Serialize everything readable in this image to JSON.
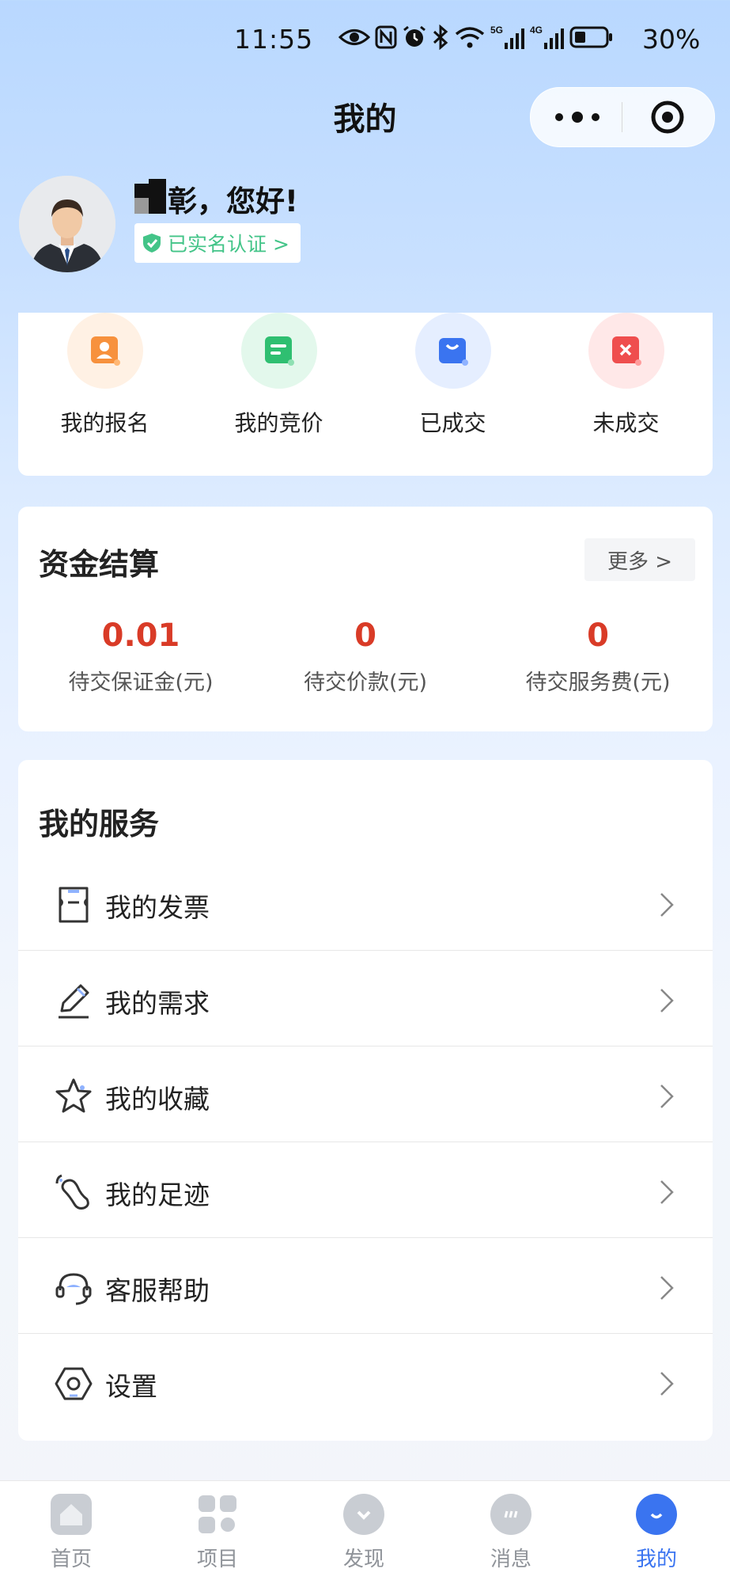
{
  "status_bar": {
    "time": "11:55",
    "battery": "30%",
    "signal_labels": [
      "5G",
      "4G"
    ]
  },
  "header": {
    "title": "我的"
  },
  "user": {
    "name_visible": "彰",
    "greeting": "彰，您好!",
    "verified_label": "已实名认证 >"
  },
  "quick_actions": [
    {
      "label": "我的报名",
      "color": "#f7913d",
      "bg": "#fff1e4",
      "icon": "registration-icon"
    },
    {
      "label": "我的竞价",
      "color": "#2fbf71",
      "bg": "#e3f8ec",
      "icon": "bidding-icon"
    },
    {
      "label": "已成交",
      "color": "#3a74f0",
      "bg": "#e5eeff",
      "icon": "deal-done-icon"
    },
    {
      "label": "未成交",
      "color": "#ef4e4e",
      "bg": "#ffe8e8",
      "icon": "deal-failed-icon"
    }
  ],
  "funds": {
    "title": "资金结算",
    "more_label": "更多 >",
    "items": [
      {
        "value": "0.01",
        "label": "待交保证金(元)"
      },
      {
        "value": "0",
        "label": "待交价款(元)"
      },
      {
        "value": "0",
        "label": "待交服务费(元)"
      }
    ]
  },
  "services": {
    "title": "我的服务",
    "items": [
      {
        "label": "我的发票",
        "icon": "invoice-icon"
      },
      {
        "label": "我的需求",
        "icon": "edit-pen-icon"
      },
      {
        "label": "我的收藏",
        "icon": "star-icon"
      },
      {
        "label": "我的足迹",
        "icon": "footprint-icon"
      },
      {
        "label": "客服帮助",
        "icon": "headset-icon"
      },
      {
        "label": "设置",
        "icon": "settings-icon"
      }
    ]
  },
  "tabbar": {
    "active": "我的",
    "items": [
      {
        "label": "首页",
        "icon": "home-icon"
      },
      {
        "label": "项目",
        "icon": "projects-icon"
      },
      {
        "label": "发现",
        "icon": "discover-icon"
      },
      {
        "label": "消息",
        "icon": "message-icon"
      },
      {
        "label": "我的",
        "icon": "profile-icon"
      }
    ]
  },
  "colors": {
    "accent": "#3a74f0",
    "value_red": "#d93b27",
    "verified_green": "#43c488"
  }
}
